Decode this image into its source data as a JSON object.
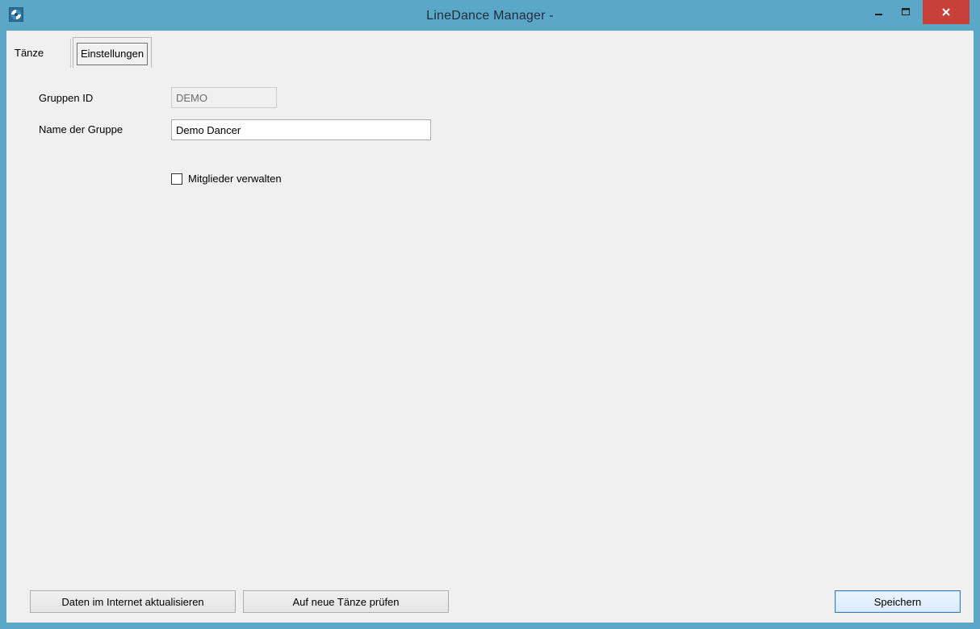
{
  "window": {
    "title": "LineDance Manager -",
    "accent_color": "#5ba7c8",
    "close_color": "#c7403a"
  },
  "tabs": [
    {
      "label": "Tänze",
      "selected": false
    },
    {
      "label": "Einstellungen",
      "selected": true
    }
  ],
  "settings": {
    "group_id_label": "Gruppen ID",
    "group_id_value": "DEMO",
    "group_name_label": "Name der Gruppe",
    "group_name_value": "Demo Dancer",
    "manage_members_label": "Mitglieder verwalten",
    "manage_members_checked": false
  },
  "buttons": {
    "update_internet": "Daten im Internet aktualisieren",
    "check_new_dances": "Auf neue Tänze prüfen",
    "save": "Speichern"
  }
}
